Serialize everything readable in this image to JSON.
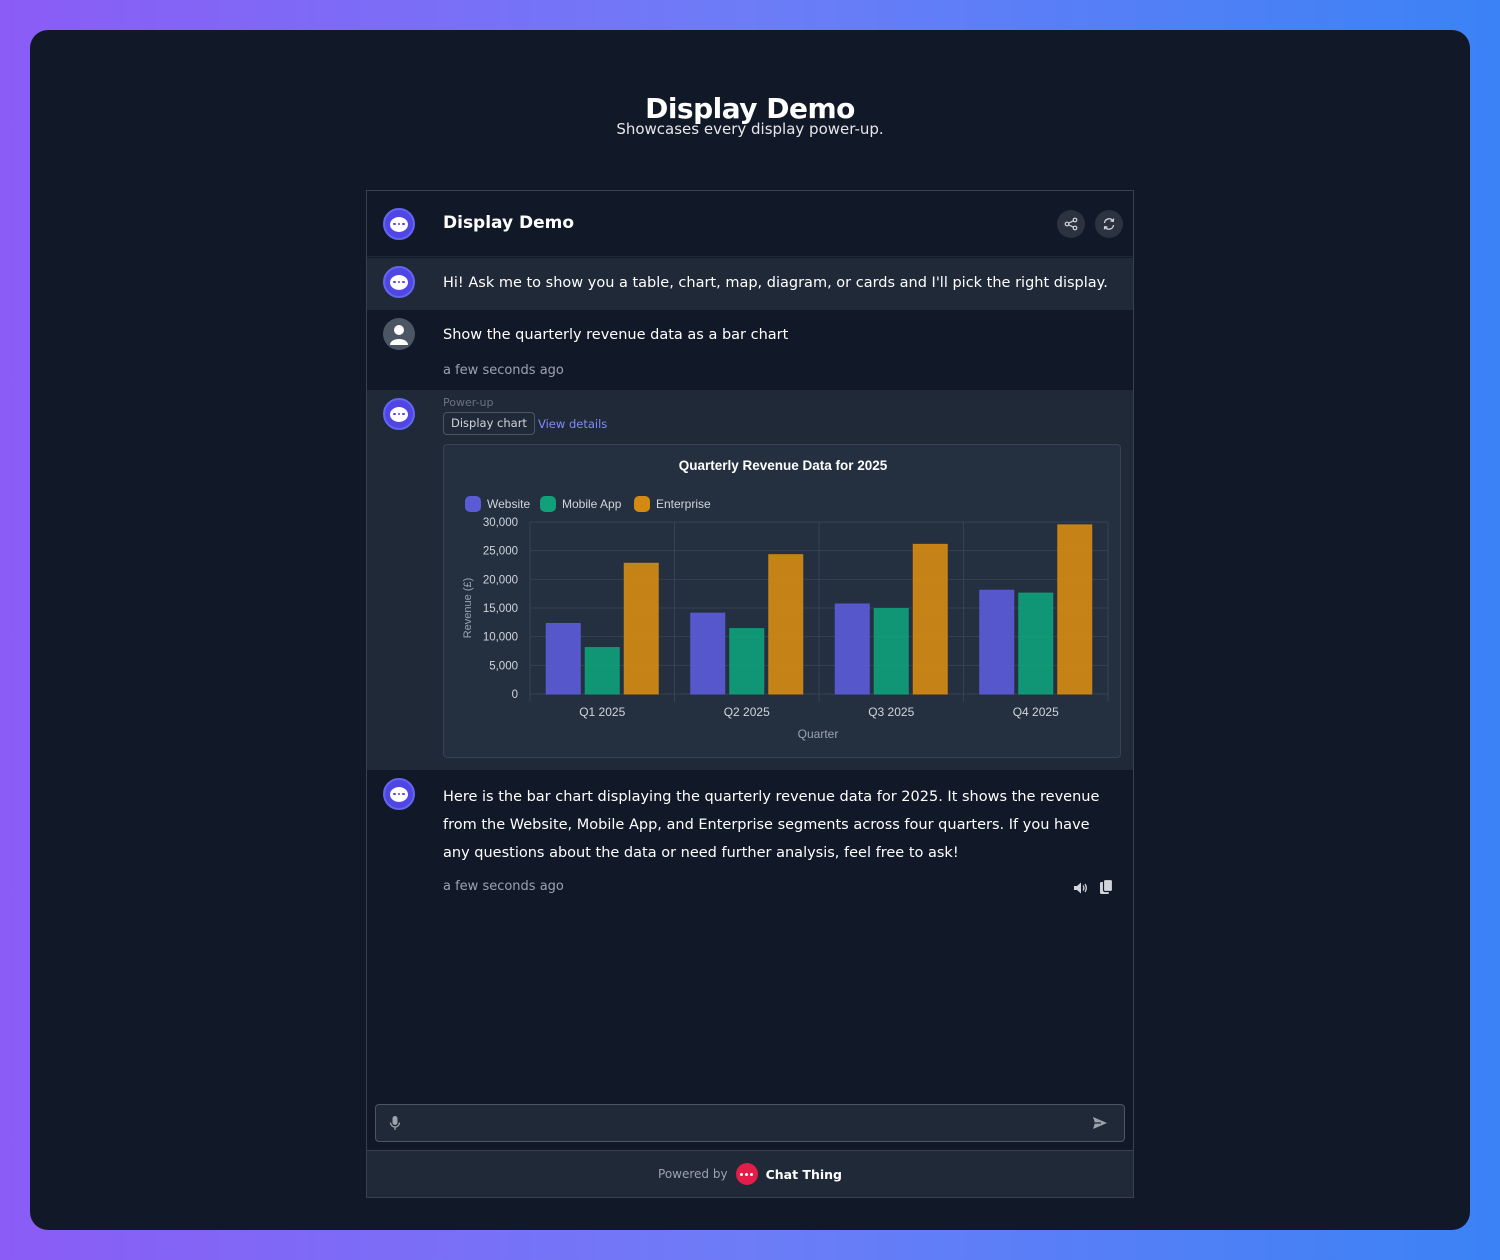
{
  "page": {
    "title": "Display Demo",
    "subtitle": "Showcases every display power-up."
  },
  "widget": {
    "title": "Display Demo",
    "share_icon": "share-icon",
    "refresh_icon": "refresh-icon"
  },
  "messages": {
    "greeting": "Hi! Ask me to show you a table, chart, map, diagram, or cards and I'll pick the right display.",
    "user": {
      "text": "Show the quarterly revenue data as a bar chart",
      "time": "a few seconds ago"
    },
    "powerup": {
      "label": "Power-up",
      "chip": "Display chart",
      "link": "View details"
    },
    "answer": {
      "text": "Here is the bar chart displaying the quarterly revenue data for 2025. It shows the revenue from the Website, Mobile App, and Enterprise segments across four quarters. If you have any questions about the data or need further analysis, feel free to ask!",
      "time": "a few seconds ago"
    }
  },
  "chart_data": {
    "type": "bar",
    "title": "Quarterly Revenue Data for 2025",
    "xlabel": "Quarter",
    "ylabel": "Revenue (£)",
    "categories": [
      "Q1 2025",
      "Q2 2025",
      "Q3 2025",
      "Q4 2025"
    ],
    "series": [
      {
        "name": "Website",
        "values": [
          12300,
          14100,
          15700,
          18100
        ],
        "color": "#5b5bd6"
      },
      {
        "name": "Mobile App",
        "values": [
          8100,
          11400,
          14900,
          17600
        ],
        "color": "#10a07a"
      },
      {
        "name": "Enterprise",
        "values": [
          22800,
          24300,
          26100,
          29500
        ],
        "color": "#d48a12"
      }
    ],
    "ylim": [
      0,
      30000
    ],
    "yticks": [
      "0",
      "5,000",
      "10,000",
      "15,000",
      "20,000",
      "25,000",
      "30,000"
    ],
    "grid": true,
    "legend": "top-left"
  },
  "input": {
    "mic_icon": "microphone-icon",
    "send_icon": "send-icon"
  },
  "footer": {
    "powered_by": "Powered by",
    "brand": "Chat Thing"
  },
  "colors": {
    "accent": "#4f46e5",
    "background": "#111827",
    "link": "#818cf8"
  }
}
